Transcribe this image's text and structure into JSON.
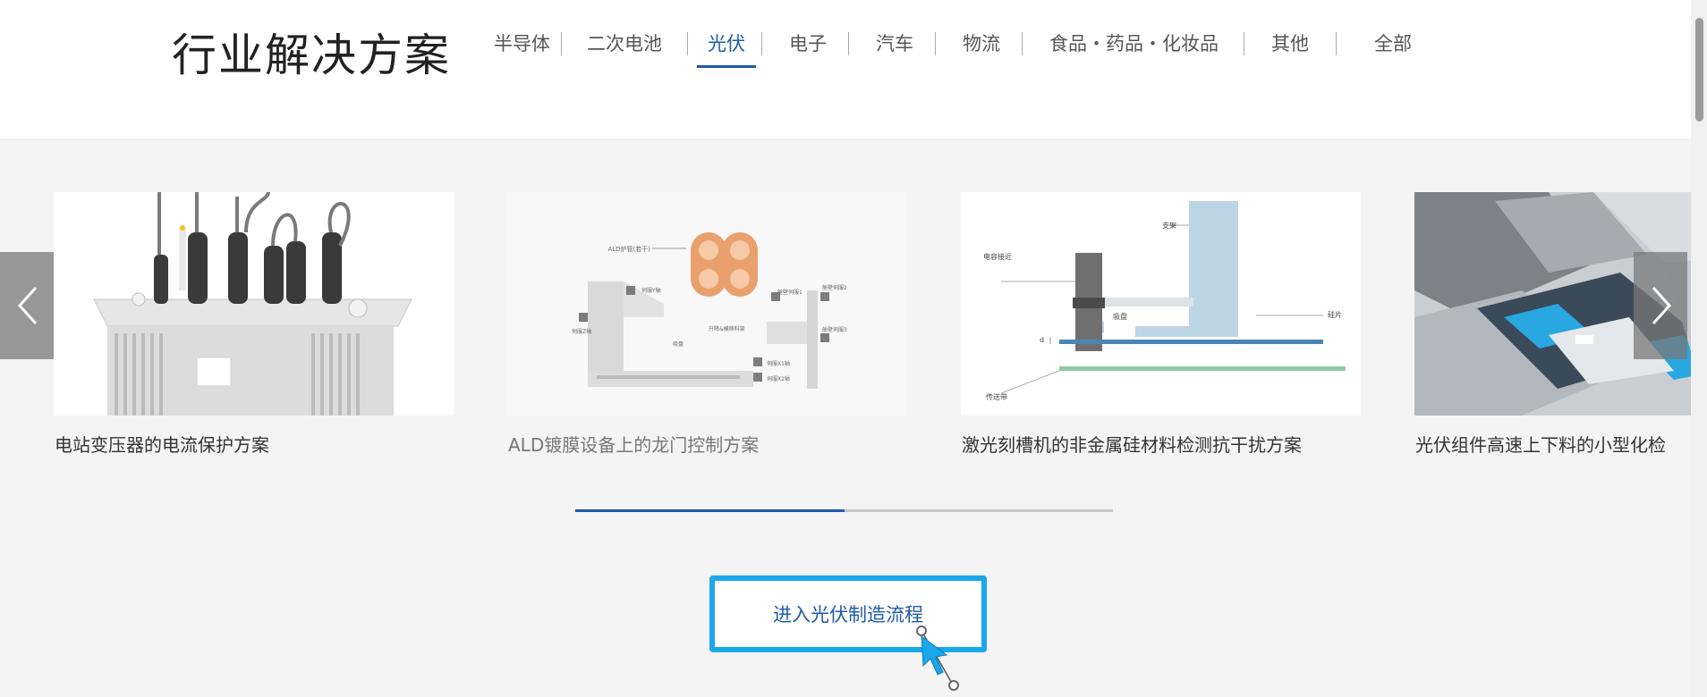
{
  "header": {
    "title": "行业解决方案",
    "tabs": [
      {
        "label": "半导体"
      },
      {
        "label": "二次电池"
      },
      {
        "label": "光伏"
      },
      {
        "label": "电子"
      },
      {
        "label": "汽车"
      },
      {
        "label": "物流"
      },
      {
        "label": "食品・药品・化妆品"
      },
      {
        "label": "其他"
      },
      {
        "label": "全部"
      }
    ],
    "active_tab": "光伏",
    "accent_color": "#1e5ba8"
  },
  "carousel": {
    "cards": [
      {
        "title": "电站变压器的电流保护方案",
        "image": "transformer"
      },
      {
        "title": "ALD镀膜设备上的龙门控制方案",
        "image": "gantry-diagram",
        "img_labels": [
          "ALD炉管(若干)",
          "伺服Y轴",
          "伺服Z轴",
          "吸盘",
          "伺服X1轴",
          "伺服X2轴",
          "舱壁伺服1",
          "舱壁伺服2",
          "舱壁伺服3",
          "升降&横移料架"
        ]
      },
      {
        "title": "激光刻槽机的非金属硅材料检测抗干扰方案",
        "image": "laser-diagram",
        "img_labels": [
          "支架",
          "电容接近",
          "吸盘",
          "硅片",
          "d",
          "传送带"
        ]
      },
      {
        "title": "光伏组件高速上下料的小型化检",
        "image": "conveyor-photo"
      }
    ],
    "prev_icon": "chevron-left-icon",
    "next_icon": "chevron-right-icon",
    "progress": 0.5
  },
  "cta": {
    "label": "进入光伏制造流程",
    "highlight_color": "#1aa7ec"
  }
}
